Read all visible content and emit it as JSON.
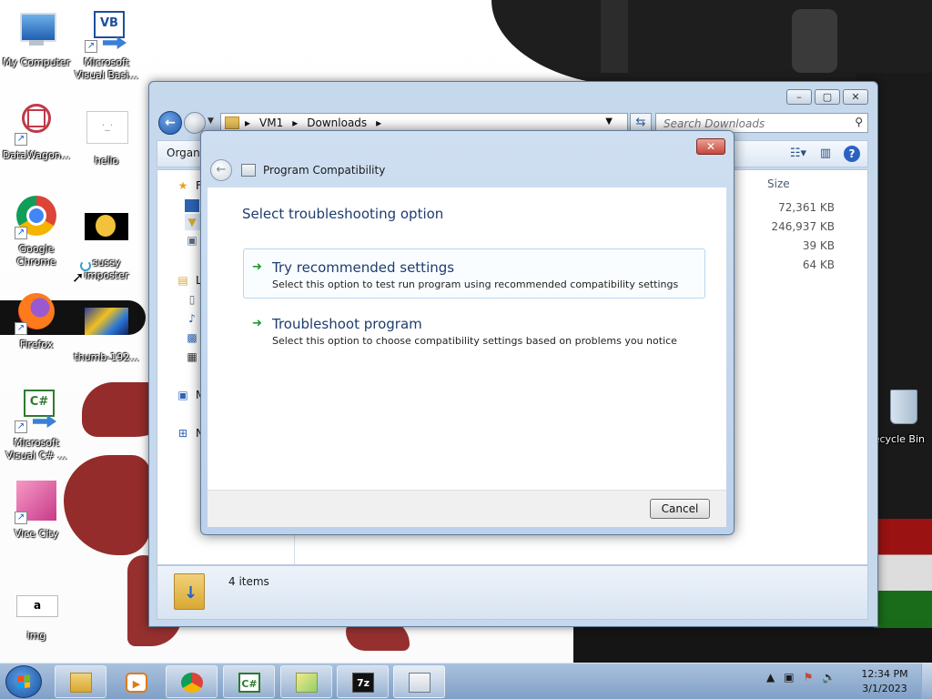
{
  "desktop": {
    "icons": [
      {
        "label": "My Computer"
      },
      {
        "label": "Microsoft Visual Basi..."
      },
      {
        "label": "DataWagon..."
      },
      {
        "label": "hello"
      },
      {
        "label": "Google Chrome"
      },
      {
        "label": "sussy imposter"
      },
      {
        "label": "Firefox"
      },
      {
        "label": "thumb-192..."
      },
      {
        "label": "Microsoft Visual C# ..."
      },
      {
        "label": "Vice City"
      },
      {
        "label": "img"
      },
      {
        "label": "Recycle Bin"
      }
    ]
  },
  "explorer": {
    "breadcrumb": [
      "VM1",
      "Downloads"
    ],
    "search_placeholder": "Search Downloads",
    "toolbar": {
      "organize_label": "Organ"
    },
    "nav_pane": {
      "items": [
        "Fa",
        "Li",
        "M",
        "N"
      ]
    },
    "columns": {
      "size": "Size"
    },
    "files": [
      {
        "size": "72,361 KB"
      },
      {
        "size": "246,937 KB"
      },
      {
        "size": "39 KB"
      },
      {
        "size": "64 KB"
      }
    ],
    "details": {
      "item_count": "4 items"
    }
  },
  "dialog": {
    "title": "Program Compatibility",
    "heading": "Select troubleshooting option",
    "options": [
      {
        "title": "Try recommended settings",
        "description": "Select this option to test run program using recommended compatibility settings"
      },
      {
        "title": "Troubleshoot program",
        "description": "Select this option to choose compatibility settings based on problems you notice"
      }
    ],
    "cancel_label": "Cancel"
  },
  "taskbar": {
    "apps": [
      "explorer",
      "media-player",
      "chrome",
      "visual-csharp",
      "desktop-folder",
      "7zip",
      "program-compatibility"
    ],
    "clock": {
      "time": "12:34 PM",
      "date": "3/1/2023"
    }
  },
  "colors": {
    "heading_blue": "#1e3c6e",
    "arrow_green": "#1e9a2e",
    "close_red": "#c8463a"
  }
}
